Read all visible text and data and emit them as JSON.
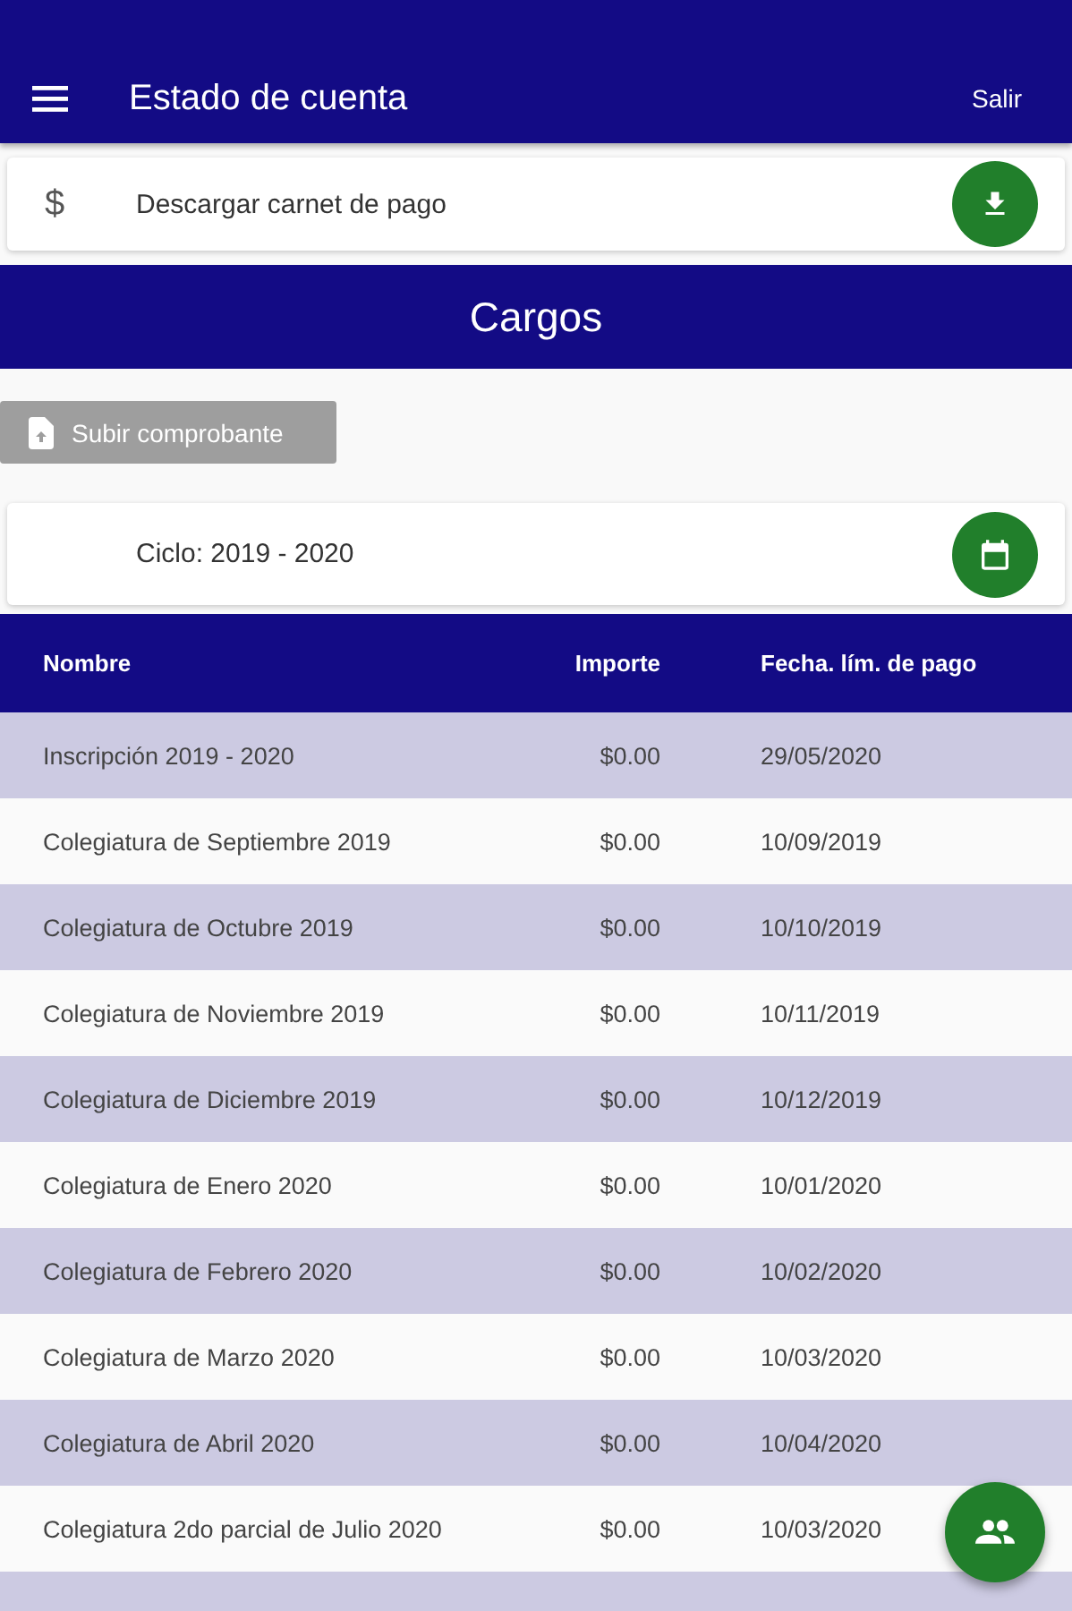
{
  "toolbar": {
    "title": "Estado de cuenta",
    "action": "Salir"
  },
  "download_card": {
    "icon_text": "$",
    "label": "Descargar carnet de pago"
  },
  "section_title": "Cargos",
  "upload_button": {
    "label": "Subir comprobante",
    "disabled": true
  },
  "cycle_card": {
    "label": "Ciclo: 2019 - 2020"
  },
  "table": {
    "columns": [
      "Nombre",
      "Importe",
      "Fecha. lím. de pago"
    ],
    "rows": [
      [
        "Inscripción 2019 - 2020",
        "$0.00",
        "29/05/2020"
      ],
      [
        "Colegiatura de Septiembre 2019",
        "$0.00",
        "10/09/2019"
      ],
      [
        "Colegiatura de Octubre 2019",
        "$0.00",
        "10/10/2019"
      ],
      [
        "Colegiatura de Noviembre 2019",
        "$0.00",
        "10/11/2019"
      ],
      [
        "Colegiatura de Diciembre 2019",
        "$0.00",
        "10/12/2019"
      ],
      [
        "Colegiatura de Enero 2020",
        "$0.00",
        "10/01/2020"
      ],
      [
        "Colegiatura de Febrero 2020",
        "$0.00",
        "10/02/2020"
      ],
      [
        "Colegiatura de Marzo 2020",
        "$0.00",
        "10/03/2020"
      ],
      [
        "Colegiatura de Abril 2020",
        "$0.00",
        "10/04/2020"
      ],
      [
        "Colegiatura 2do parcial de Julio 2020",
        "$0.00",
        "10/03/2020"
      ]
    ]
  }
}
